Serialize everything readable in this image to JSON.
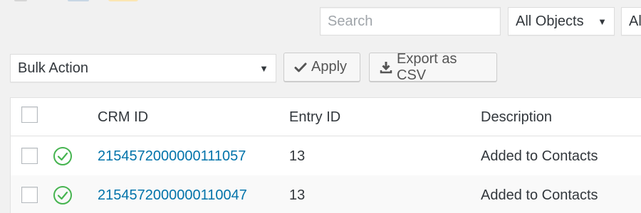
{
  "filters": {
    "search_placeholder": "Search",
    "objects_select": "All Objects",
    "second_select": "Al"
  },
  "actions": {
    "bulk_action": "Bulk Action",
    "apply_label": "Apply",
    "export_label": "Export as CSV"
  },
  "table": {
    "headers": {
      "crm_id": "CRM ID",
      "entry_id": "Entry ID",
      "description": "Description"
    },
    "rows": [
      {
        "status": "check-circle-icon",
        "crm_id": "2154572000000111057",
        "entry_id": "13",
        "description": "Added to Contacts"
      },
      {
        "status": "check-circle-icon",
        "crm_id": "2154572000000110047",
        "entry_id": "13",
        "description": "Added to Contacts"
      }
    ]
  },
  "colors": {
    "link": "#0073aa",
    "success": "#46b450",
    "background": "#f1f1f1"
  }
}
